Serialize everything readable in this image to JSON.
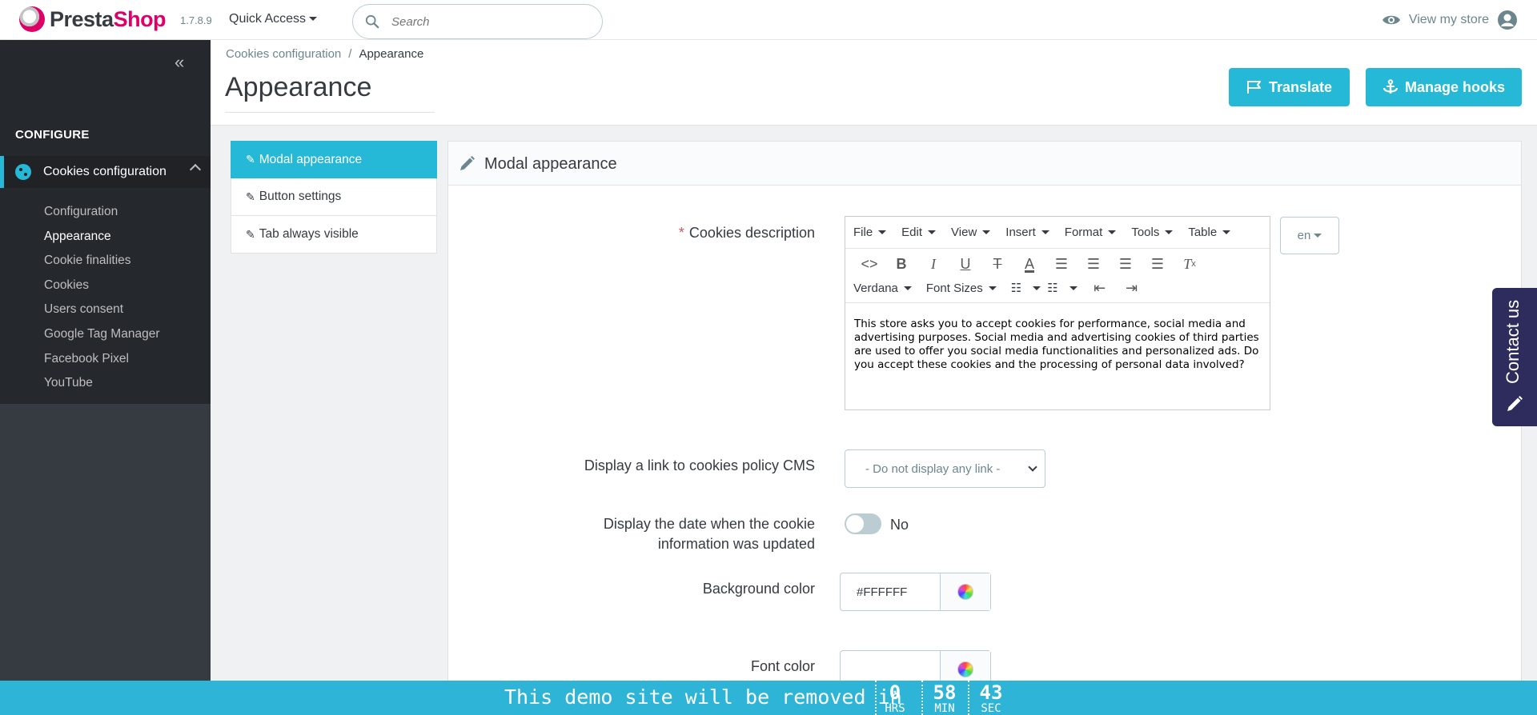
{
  "header": {
    "brand_presta": "Presta",
    "brand_shop": "Shop",
    "version": "1.7.8.9",
    "quick_access": "Quick Access",
    "search_placeholder": "Search",
    "view_store": "View my store"
  },
  "sidebar": {
    "collapse": "«",
    "section": "CONFIGURE",
    "module": "Cookies configuration",
    "items": [
      {
        "label": "Configuration",
        "active": false
      },
      {
        "label": "Appearance",
        "active": true
      },
      {
        "label": "Cookie finalities",
        "active": false
      },
      {
        "label": "Cookies",
        "active": false
      },
      {
        "label": "Users consent",
        "active": false
      },
      {
        "label": "Google Tag Manager",
        "active": false
      },
      {
        "label": "Facebook Pixel",
        "active": false
      },
      {
        "label": "YouTube",
        "active": false
      }
    ]
  },
  "toolbar": {
    "breadcrumb_parent": "Cookies configuration",
    "breadcrumb_sep": "/",
    "breadcrumb_current": "Appearance",
    "title": "Appearance",
    "translate_label": "Translate",
    "hooks_label": "Manage hooks"
  },
  "tabs": [
    {
      "label": "Modal appearance",
      "active": true
    },
    {
      "label": "Button settings",
      "active": false
    },
    {
      "label": "Tab always visible",
      "active": false
    }
  ],
  "panel": {
    "title": "Modal appearance",
    "cookies_description_label": "Cookies description",
    "required_mark": "*",
    "editor": {
      "menus": [
        "File",
        "Edit",
        "View",
        "Insert",
        "Format",
        "Tools",
        "Table"
      ],
      "font": "Verdana",
      "font_sizes": "Font Sizes",
      "content": "This store asks you to accept cookies for performance, social media and advertising purposes. Social media and advertising cookies of third parties are used to offer you social media functionalities and personalized ads. Do you accept these cookies and the processing of personal data involved?"
    },
    "language": "en",
    "cms_link_label": "Display a link to cookies policy CMS",
    "cms_link_value": "- Do not display any link -",
    "date_label_line1": "Display the date when the cookie",
    "date_label_line2": "information was updated",
    "date_toggle": "No",
    "bg_color_label": "Background color",
    "bg_color_value": "#FFFFFF",
    "font_color_label": "Font color",
    "font_color_value": ""
  },
  "contact": {
    "label": "Contact us"
  },
  "demo": {
    "text": "This demo site will be removed in",
    "hrs": "0",
    "hrs_label": "HRS",
    "min": "58",
    "min_label": "MIN",
    "sec": "43",
    "sec_label": "SEC"
  }
}
